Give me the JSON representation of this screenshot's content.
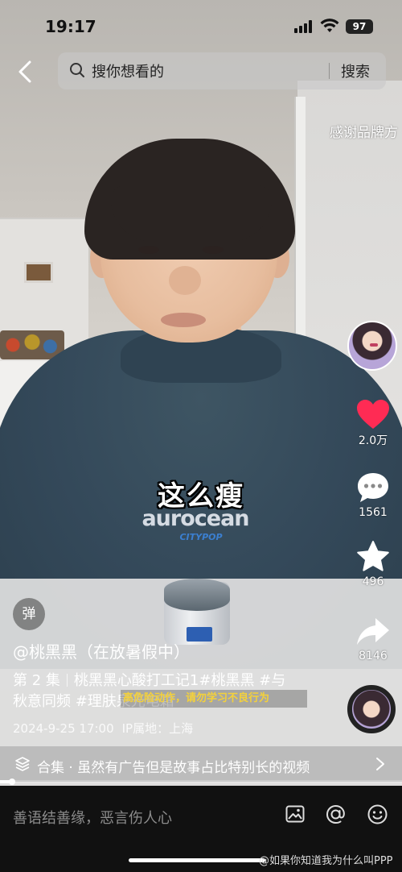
{
  "status_bar": {
    "time": "19:17",
    "battery": "97"
  },
  "search": {
    "placeholder": "搜你想看的",
    "button": "搜索"
  },
  "overlay": {
    "brand_thanks": "感谢品牌方",
    "subtitle": "这么瘦"
  },
  "shirt_print": {
    "brand": "aurocean",
    "sub": "CITYPOP"
  },
  "sidebar": {
    "like_count": "2.0万",
    "comment_count": "1561",
    "favorite_count": "496",
    "share_count": "8146"
  },
  "video_info": {
    "danmu_label": "弹",
    "author": "@桃黑黑（在放暑假中）",
    "episode": "第 2 集",
    "description_line1": "桃黑黑心酸打工记1#桃黑黑 #与",
    "description_line2": "秋意同频 #理肤泉光电霜",
    "warning": "高危险动作，请勿学习不良行为",
    "date": "2024-9-25 17:00",
    "ip_location": "IP属地：上海"
  },
  "collection": {
    "text": "合集 · 虽然有广告但是故事占比特别长的视频"
  },
  "progress": {
    "played_fraction": 0.03
  },
  "comment_bar": {
    "placeholder": "善语结善缘，恶言伤人心"
  },
  "watermark": "@如果你知道我为什么叫PPP",
  "icons": [
    "back-icon",
    "search-icon",
    "heart-icon",
    "comment-icon",
    "star-icon",
    "share-icon",
    "collection-icon",
    "chevron-right-icon",
    "image-icon",
    "at-icon",
    "emoji-icon"
  ],
  "colors": {
    "like": "#ff2b54",
    "warning": "#f4d13a",
    "bottom_bar": "#111111"
  }
}
